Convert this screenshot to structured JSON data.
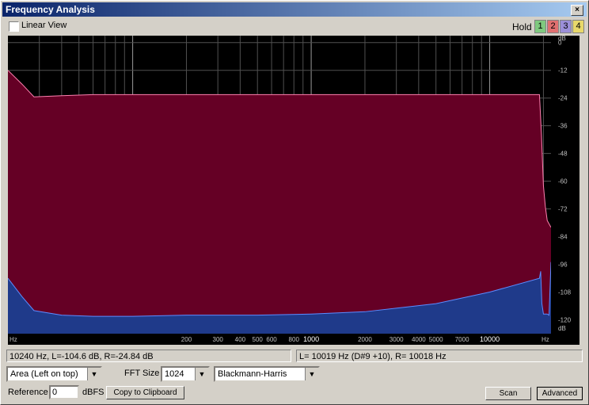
{
  "window": {
    "title": "Frequency Analysis",
    "close_label": "×"
  },
  "toolbar": {
    "linear_view_label": "Linear View",
    "hold_label": "Hold",
    "hold_buttons": [
      {
        "label": "1",
        "color": "#7fc97f"
      },
      {
        "label": "2",
        "color": "#e07070"
      },
      {
        "label": "3",
        "color": "#9b8fd8"
      },
      {
        "label": "4",
        "color": "#e8d86a"
      }
    ]
  },
  "chart_data": {
    "type": "area",
    "xscale": "log",
    "xlim": [
      20,
      22050
    ],
    "ylim": [
      -126,
      3
    ],
    "grid": true,
    "x_tick_labels": [
      {
        "label": "Hz",
        "x": 20
      },
      {
        "label": "200",
        "x": 200
      },
      {
        "label": "300",
        "x": 300
      },
      {
        "label": "400",
        "x": 400
      },
      {
        "label": "500",
        "x": 500
      },
      {
        "label": "600",
        "x": 600
      },
      {
        "label": "800",
        "x": 800
      },
      {
        "label": "1000",
        "x": 1000
      },
      {
        "label": "2000",
        "x": 2000
      },
      {
        "label": "3000",
        "x": 3000
      },
      {
        "label": "4000",
        "x": 4000
      },
      {
        "label": "5000",
        "x": 5000
      },
      {
        "label": "7000",
        "x": 7000
      },
      {
        "label": "10000",
        "x": 10000
      },
      {
        "label": "Hz",
        "x": 22050
      }
    ],
    "y_tick_labels": [
      "dB",
      "0",
      "-12",
      "-24",
      "-36",
      "-48",
      "-60",
      "-72",
      "-84",
      "-96",
      "-108",
      "-120",
      "dB"
    ],
    "y_ticks": [
      0,
      -12,
      -24,
      -36,
      -48,
      -60,
      -72,
      -84,
      -96,
      -108,
      -120
    ],
    "series": [
      {
        "color": "#650025",
        "line_color": "#ff80b0",
        "x": [
          20,
          24,
          28,
          40,
          60,
          100,
          200,
          500,
          1000,
          2000,
          5000,
          10000,
          19000,
          19500,
          20000,
          20500,
          21000,
          22050
        ],
        "y": [
          -12,
          -18,
          -23.5,
          -23,
          -22.5,
          -22.5,
          -22.5,
          -22.5,
          -22.5,
          -22.5,
          -22.5,
          -22.5,
          -22.5,
          -40,
          -62,
          -71,
          -77,
          -80
        ]
      },
      {
        "color": "#1f3a8a",
        "line_color": "#5c8cff",
        "x": [
          20,
          24,
          28,
          40,
          60,
          100,
          200,
          500,
          1000,
          2000,
          5000,
          10000,
          19000,
          19300,
          19600,
          20000,
          21000,
          21500,
          22050
        ],
        "y": [
          -102,
          -110,
          -116,
          -118,
          -118.5,
          -118.5,
          -118,
          -118,
          -117.5,
          -116.5,
          -113,
          -108,
          -102,
          -99,
          -113,
          -117.5,
          -117.5,
          -118,
          -95
        ]
      }
    ]
  },
  "status": {
    "cursor_readout": "10240 Hz, L=-104.6 dB, R=-24.84 dB",
    "peak_readout": "L=  10019 Hz (D#9 +10), R=  10018 Hz"
  },
  "controls": {
    "display_mode": "Area (Left on top)",
    "fft_size_label": "FFT Size",
    "fft_size": "1024",
    "window_function": "Blackmann-Harris",
    "reference_label": "Reference",
    "reference_value": "0",
    "dbfs_label": "dBFS",
    "copy_label": "Copy to Clipboard",
    "scan_label": "Scan",
    "advanced_label": "Advanced"
  }
}
